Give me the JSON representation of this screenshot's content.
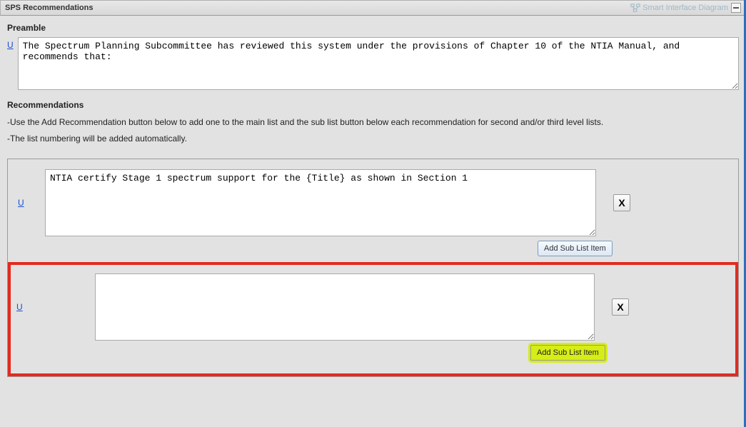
{
  "header": {
    "title": "SPS Recommendations",
    "smartInterfaceLabel": "Smart Interface Diagram"
  },
  "preamble": {
    "heading": "Preamble",
    "uLabel": "U",
    "text": "The Spectrum Planning Subcommittee has reviewed this system under the provisions of Chapter 10 of the NTIA Manual, and recommends that:"
  },
  "recommendations": {
    "heading": "Recommendations",
    "instruction1": "-Use the Add Recommendation button below to add one to the main list and the sub list button below each recommendation for second and/or third level lists.",
    "instruction2": "-The list numbering will be added automatically.",
    "items": [
      {
        "uLabel": "U",
        "text": "NTIA certify Stage 1 spectrum support for the {Title} as shown in Section 1",
        "deleteLabel": "X",
        "addSubLabel": "Add Sub List Item"
      },
      {
        "uLabel": "U",
        "text": "",
        "deleteLabel": "X",
        "addSubLabel": "Add Sub List Item"
      }
    ]
  }
}
